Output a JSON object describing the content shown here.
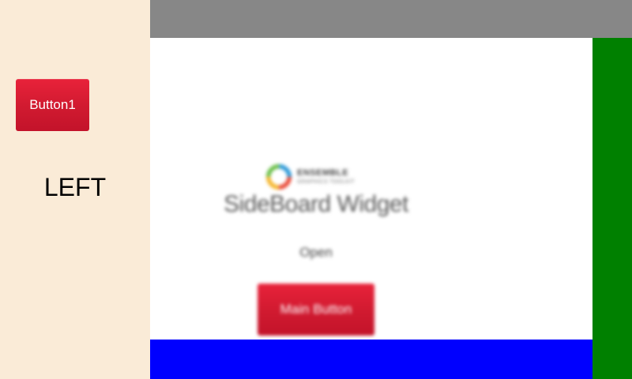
{
  "left_panel": {
    "button_label": "Button1",
    "label": "LEFT"
  },
  "main": {
    "logo": {
      "brand": "ENSEMBLE",
      "tagline": "GRAPHICS TOOLKIT"
    },
    "title": "SideBoard Widget",
    "status": "Open",
    "button_label": "Main Button"
  },
  "colors": {
    "left_panel_bg": "#faebd7",
    "top_bar": "#878787",
    "right_bar": "#008000",
    "bottom_bar": "#0000ff",
    "button_red": "#d01a30"
  },
  "icons": {
    "logo": "ensemble-ring-logo-icon"
  }
}
